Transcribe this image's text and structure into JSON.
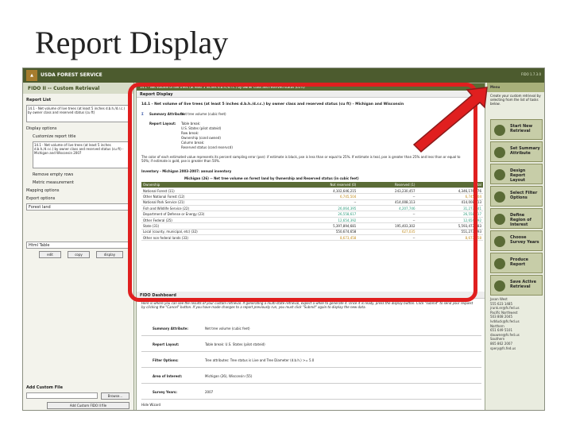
{
  "slide_title": "Report Display",
  "app": {
    "agency": "USDA FOREST SERVICE",
    "version": "FIDO 1.7.3.0",
    "left_title": "FIDO II -- Custom Retrieval"
  },
  "left_panel": {
    "report_list_label": "Report List",
    "report_item": "14.1 - Net volume of live trees (at least 5 inches d.b.h./d.r.c.) by owner class and reserved status (cu ft)",
    "display_options_label": "Display options",
    "customize_title_label": "Customize report title",
    "title_text": "14.1 - Net volume of live trees (at least 5 inches d.b.h./d.r.c.) by owner class and reserved status (cu ft) - Michigan and Wisconsin 2007",
    "remove_empty_rows": "Remove empty rows",
    "metric_measurement": "Metric measurement",
    "mapping_options": "Mapping options",
    "export_options": "Export options",
    "export_format": "Forest land",
    "html_table": "Html Table",
    "buttons": [
      "edit",
      "copy",
      "display"
    ],
    "add_custom_file": "Add Custom File",
    "browse": "Browse...",
    "add_custom_fido_file": "Add Custom FIDO II file"
  },
  "main": {
    "top_title": "14.1 - Net volume of live trees (at least 5 inches d.b.h./d.r.c.) by owner class and reserved status (cu ft)",
    "report_display_label": "Report Display",
    "report_title": "14.1 - Net volume of live trees (at least 5 inches d.b.h./d.r.c.) by owner class and reserved status (cu ft) - Michigan and Wisconsin",
    "summary_attribute_label": "Summary Attribute:",
    "summary_attribute_value": "Net tree volume (cubic feet)",
    "report_layout_label": "Report Layout:",
    "layout_lines": [
      "Table break:",
      "U.S. States (pilot stateid)",
      "Row break:",
      "Ownership (cond owned)",
      "Column break:",
      "Reserved status (cond reservcd)"
    ],
    "color_note": "The color of each estimated value represents its percent sampling error (pse): if estimate is black, pse is less than or equal to 25%. If estimate is teal, pse is greater than 25% and less than or equal to 50%; if estimate is gold, pse is greater than 50%.",
    "inventory_label": "Inventory - Michigan 2003-2007: annual inventory",
    "table_caption": "Michigan (26) -- Net tree volume on forest land by Ownership and Reserved status (in cubic feet)",
    "columns": [
      "Ownership",
      "Not reserved (0)",
      "Reserved (1)",
      "Total"
    ],
    "rows": [
      {
        "name": "National Forest (11)",
        "nr": "4,102,646,215",
        "r": "243,230,457",
        "t": "4,346,176,676",
        "nr_c": "",
        "r_c": "",
        "t_c": ""
      },
      {
        "name": "Other National Forest (12)",
        "nr": "6,745,504",
        "r": "--",
        "t": "6,745,504",
        "nr_c": "gold",
        "r_c": "",
        "t_c": "gold"
      },
      {
        "name": "National Park Service (21)",
        "nr": "--",
        "r": "414,008,113",
        "t": "414,008,113",
        "nr_c": "",
        "r_c": "",
        "t_c": ""
      },
      {
        "name": "Fish and Wildlife Service (22)",
        "nr": "26,064,395",
        "r": "4,207,746",
        "t": "31,273,041",
        "nr_c": "teal",
        "r_c": "teal",
        "t_c": "teal"
      },
      {
        "name": "Department of Defense or Energy (23)",
        "nr": "26,558,617",
        "r": "--",
        "t": "26,558,617",
        "nr_c": "teal",
        "r_c": "",
        "t_c": "teal"
      },
      {
        "name": "Other Federal (25)",
        "nr": "12,654,392",
        "r": "--",
        "t": "12,654,392",
        "nr_c": "teal",
        "r_c": "",
        "t_c": "teal"
      },
      {
        "name": "State (31)",
        "nr": "5,397,894,681",
        "r": "195,403,302",
        "t": "5,593,473,983",
        "nr_c": "",
        "r_c": "",
        "t_c": ""
      },
      {
        "name": "Local (county, municipal, etc) (32)",
        "nr": "550,674,658",
        "r": "627,035",
        "t": "551,273,693",
        "nr_c": "",
        "r_c": "gold",
        "t_c": ""
      },
      {
        "name": "Other non federal lands (33)",
        "nr": "8,673,458",
        "r": "--",
        "t": "8,673,458",
        "nr_c": "gold",
        "r_c": "",
        "t_c": "gold"
      }
    ],
    "fido_dashboard_label": "FIDO Dashboard",
    "dashboard_note": "Here is where you can see the results of your custom retrieval. If generating a multi-state retrieval, expect a while to generate it. Once it is ready, press the display button. Click \"submit\" to send your request by clicking the \"Cancel\" button. If you have made changes to a report previously run, you must click \"Submit\" again to display the new data.",
    "dash_rows": [
      {
        "label": "Summary Attribute:",
        "value": "Net tree volume (cubic feet)"
      },
      {
        "label": "Report Layout:",
        "value": "Table break: U.S. States (pilot stateid)"
      },
      {
        "label": "Filter Options:",
        "value": "Tree attributes: Tree status is Live and Tree Diameter (d.b.h.) >= 5.0"
      },
      {
        "label": "Area of Interest:",
        "value": "Michigan (26), Wisconsin (55)"
      },
      {
        "label": "Survey Years:",
        "value": "2007"
      }
    ],
    "hide_wizard": "Hide Wizard"
  },
  "right_panel": {
    "menu_label": "Menu",
    "menu_note": "Create your custom retrieval by selecting from the list of tasks below.",
    "steps": [
      "Start New Retrieval",
      "Set Summary Attribute",
      "Design Report Layout",
      "Select Filter Options",
      "Define Region of Interest",
      "Choose Survey Years",
      "Produce Report",
      "Save Active Retrieval"
    ],
    "contacts": [
      "Jason West",
      "555 623 1485",
      "jrunk.er@fs.fed.us",
      "Pacific Northwest",
      "503 808 2045",
      "lvdduck@fs.fed.us",
      "Northern",
      "651 649 5101",
      "dauwne@fs.fed.us",
      "Southern",
      "865 862 2007",
      "spery@fs.fed.us"
    ]
  }
}
